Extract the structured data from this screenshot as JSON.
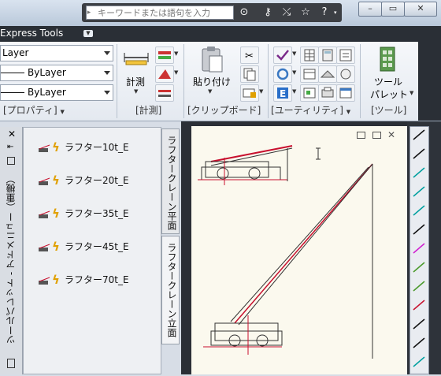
{
  "search": {
    "placeholder": "キーワードまたは語句を入力"
  },
  "window_buttons": {
    "minimize": "–",
    "restore": "▭",
    "close": "✕"
  },
  "ribbon": {
    "tab_label": "Express Tools",
    "properties": {
      "layer_value": "Layer",
      "linetype_value": "ByLayer",
      "lineweight_value": "ByLayer",
      "panel_label": "[プロパティ]"
    },
    "measure": {
      "label": "計測",
      "panel_label": "[計測]"
    },
    "clipboard": {
      "paste_label": "貼り付け",
      "panel_label": "[クリップボード]"
    },
    "utilities": {
      "panel_label": "[ユーティリティ]"
    },
    "tools": {
      "palette_label_line1": "ツール",
      "palette_label_line2": "パレット",
      "panel_label": "[ツール]"
    }
  },
  "tool_palette": {
    "title": "ツールパレット - アドメニュー（重機）",
    "close": "✕",
    "items": [
      {
        "label": "ラフター10t_E"
      },
      {
        "label": "ラフター20t_E"
      },
      {
        "label": "ラフター35t_E"
      },
      {
        "label": "ラフター45t_E"
      },
      {
        "label": "ラフター70t_E"
      }
    ],
    "tabs": [
      {
        "label": "ラフタークレーン平面"
      },
      {
        "label": "ラフタークレーン立面"
      }
    ]
  },
  "colors": {
    "accent_bolt": "#e0a000",
    "ribbon_dark": "#2a2f36",
    "canvas_bg": "#fbf9ee",
    "crane_red": "#c8102e"
  },
  "icons": [
    "search-icon",
    "binoculars-icon",
    "key-icon",
    "exchange-icon",
    "star-icon",
    "help-icon"
  ]
}
